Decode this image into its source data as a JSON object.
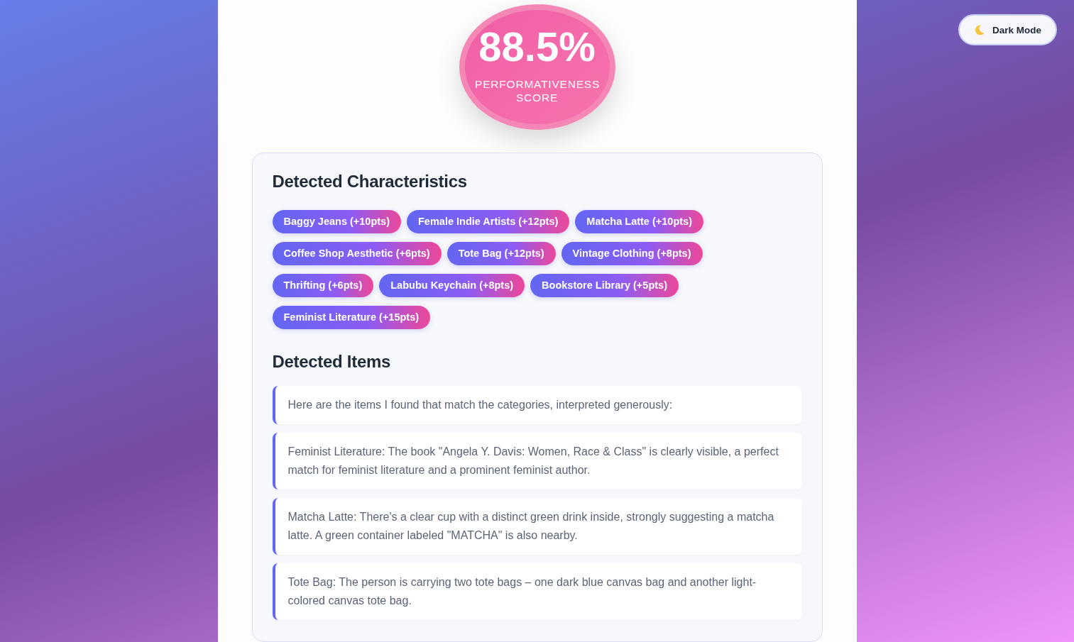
{
  "theme_toggle": {
    "label": "Dark Mode"
  },
  "score": {
    "value": "88.5%",
    "label": "PERFORMATIVENESS SCORE"
  },
  "characteristics": {
    "title": "Detected Characteristics",
    "tags": [
      {
        "label": "Baggy Jeans (+10pts)"
      },
      {
        "label": "Female Indie Artists (+12pts)"
      },
      {
        "label": "Matcha Latte (+10pts)"
      },
      {
        "label": "Coffee Shop Aesthetic (+6pts)"
      },
      {
        "label": "Tote Bag (+12pts)"
      },
      {
        "label": "Vintage Clothing (+8pts)"
      },
      {
        "label": "Thrifting (+6pts)"
      },
      {
        "label": "Labubu Keychain (+8pts)"
      },
      {
        "label": "Bookstore Library (+5pts)"
      },
      {
        "label": "Feminist Literature (+15pts)"
      }
    ]
  },
  "items": {
    "title": "Detected Items",
    "entries": [
      "Here are the items I found that match the categories, interpreted generously:",
      "Feminist Literature: The book \"Angela Y. Davis: Women, Race & Class\" is clearly visible, a perfect match for feminist literature and a prominent feminist author.",
      "Matcha Latte: There's a clear cup with a distinct green drink inside, strongly suggesting a matcha latte. A green container labeled \"MATCHA\" is also nearby.",
      "Tote Bag: The person is carrying two tote bags – one dark blue canvas bag and another light-colored canvas tote bag."
    ]
  }
}
